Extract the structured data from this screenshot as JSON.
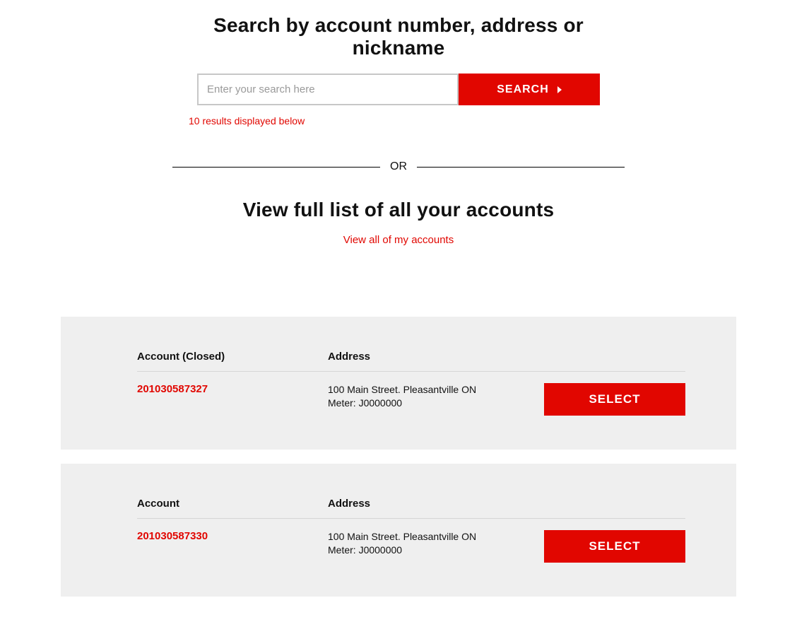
{
  "search": {
    "title": "Search by account number, address or nickname",
    "placeholder": "Enter your search here",
    "button_label": "SEARCH",
    "status": "10 results displayed below",
    "value": ""
  },
  "divider": {
    "label": "OR"
  },
  "list": {
    "title": "View full list of all your accounts",
    "view_all_link": "View all of my accounts"
  },
  "headers": {
    "account": "Account",
    "address": "Address",
    "select_label": "SELECT",
    "closed_suffix": " (Closed)",
    "meter_prefix": "Meter: "
  },
  "accounts": [
    {
      "closed": true,
      "number": "201030587327",
      "address": "100 Main Street. Pleasantville ON",
      "meter": "J0000000"
    },
    {
      "closed": false,
      "number": "201030587330",
      "address": "100 Main Street. Pleasantville ON",
      "meter": "J0000000"
    }
  ]
}
